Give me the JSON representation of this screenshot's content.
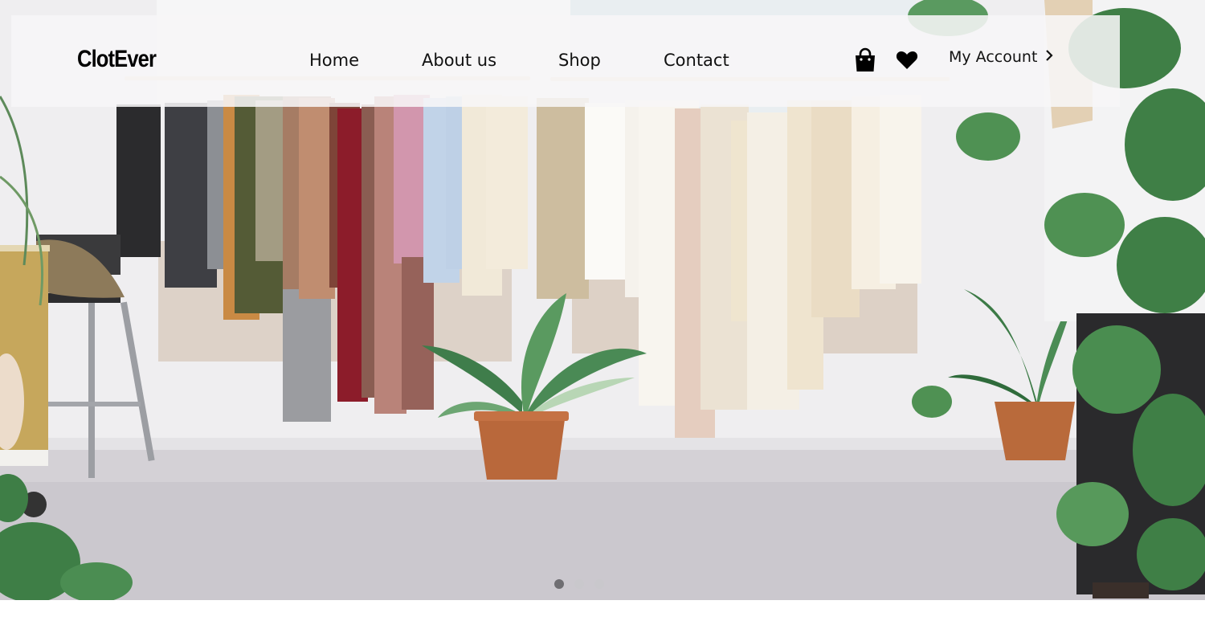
{
  "brand": {
    "name": "ClotEver"
  },
  "nav": {
    "links": [
      "Home",
      "About us",
      "Shop",
      "Contact"
    ],
    "cart_icon": "shopping-bag-icon",
    "wishlist_icon": "heart-icon",
    "account_label": "My Account",
    "account_icon": "chevron-right-icon"
  },
  "hero": {
    "image": "clothing-rack-boutique-photo",
    "slides": 3,
    "active_slide": 1
  },
  "colors": {
    "nav_bg": "#f7f6f7",
    "text": "#111111",
    "dot_active": "#6f6e72",
    "dot_inactive": "#c9c8cc"
  }
}
